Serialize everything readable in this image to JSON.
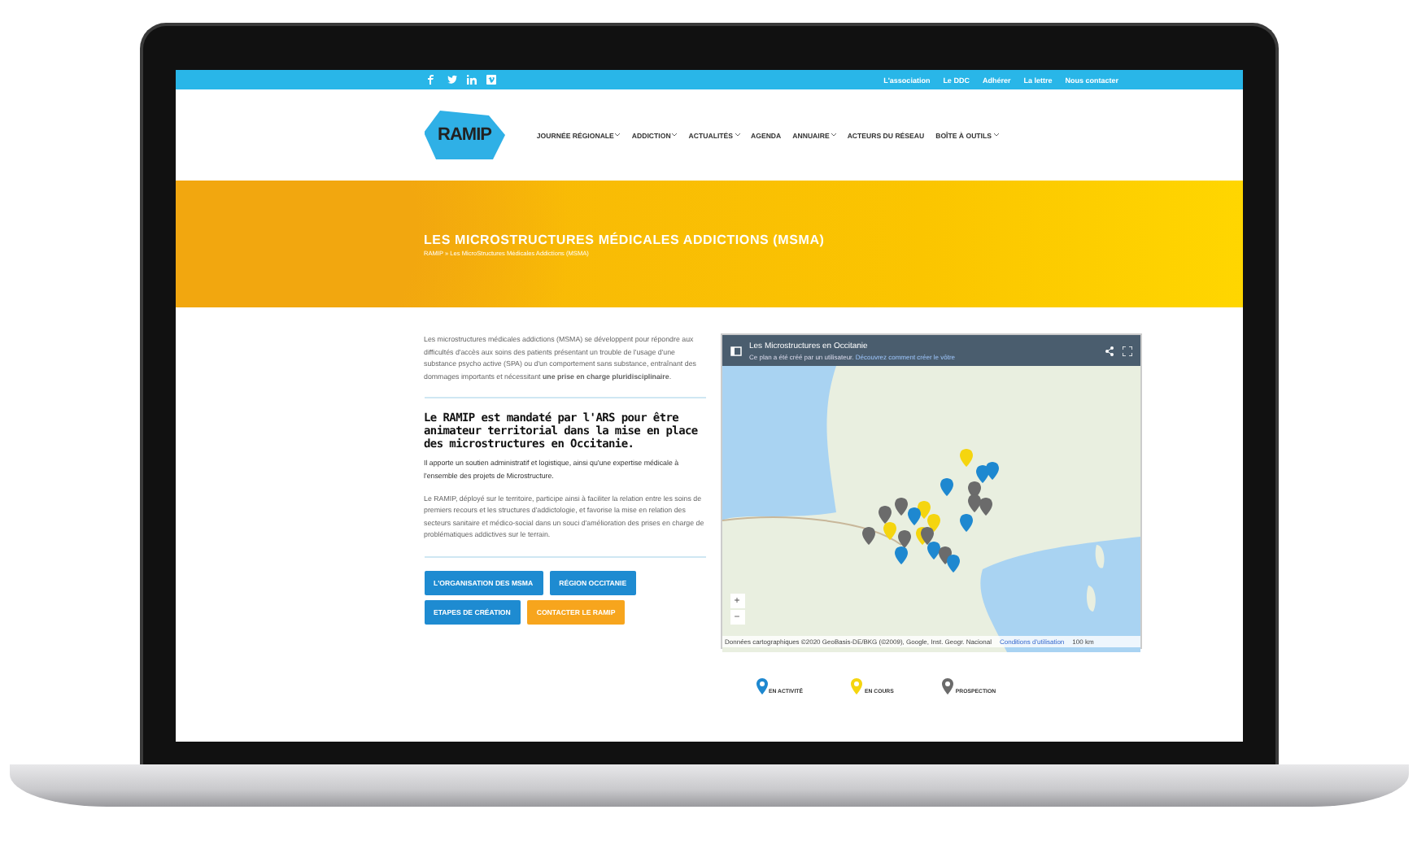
{
  "topbar": {
    "social": [
      {
        "kind": "facebook"
      },
      {
        "kind": "twitter"
      },
      {
        "kind": "linkedin"
      },
      {
        "kind": "vimeo"
      }
    ],
    "links": [
      "L'association",
      "Le DDC",
      "Adhérer",
      "La lettre",
      "Nous contacter"
    ]
  },
  "header": {
    "logo": "RAMIP",
    "nav": [
      {
        "label": "JOURNÉE RÉGIONALE",
        "has_menu": true
      },
      {
        "label": "ADDICTION",
        "has_menu": true
      },
      {
        "label": "ACTUALITÉS",
        "has_menu": true
      },
      {
        "label": "AGENDA",
        "has_menu": false
      },
      {
        "label": "ANNUAIRE",
        "has_menu": true
      },
      {
        "label": "ACTEURS DU RÉSEAU",
        "has_menu": false
      },
      {
        "label": "BOÎTE À OUTILS",
        "has_menu": true
      }
    ]
  },
  "banner": {
    "title": "LES MICROSTRUCTURES MÉDICALES ADDICTIONS (MSMA)",
    "breadcrumb": "RAMIP » Les MicroStructures Médicales Addictions (MSMA)"
  },
  "intro": "Les microstructures médicales addictions (MSMA) se développent pour répondre aux difficultés d'accès aux soins des patients présentant un trouble de l'usage d'une substance psycho active (SPA) ou d'un comportement sans substance, entraînant des dommages importants et nécessitant **une prise en charge pluridisciplinaire**.",
  "heading": "Le RAMIP est mandaté par l'ARS pour être animateur territorial dans la mise en place des microstructures en Occitanie.",
  "paragraphs": [
    "Il apporte un soutien administratif et logistique, ainsi qu'une expertise médicale à l'ensemble des projets de Microstructure.",
    "Le RAMIP, déployé sur le territoire, participe ainsi à faciliter la relation entre les soins de premiers recours et les structures d'addictologie, et favorise la mise en relation des secteurs sanitaire et médico-social dans un souci d'amélioration des prises en charge de problématiques addictives sur le terrain."
  ],
  "buttons": [
    {
      "label": "L'ORGANISATION DES MSMA",
      "kind": "primary"
    },
    {
      "label": "RÉGION OCCITANIE",
      "kind": "primary"
    },
    {
      "label": "ETAPES DE CRÉATION",
      "kind": "primary"
    },
    {
      "label": "CONTACTER LE RAMIP",
      "kind": "accent"
    }
  ],
  "map": {
    "title": "Les Microstructures en Occitanie",
    "note": "Ce plan a été créé par un utilisateur.",
    "note_link": "Découvrez comment créer le vôtre",
    "zoom_in": "+",
    "zoom_out": "−",
    "attribution": "Données cartographiques ©2020 GeoBasis-DE/BKG (©2009), Google, Inst. Geogr. Nacional",
    "terms": "Conditions d'utilisation",
    "scale": "100 km"
  },
  "legend": [
    {
      "label": "EN ACTIVITÉ",
      "color": "#1e88d0"
    },
    {
      "label": "EN COURS",
      "color": "#f5d50f"
    },
    {
      "label": "PROSPECTION",
      "color": "#6b6b6b"
    }
  ]
}
